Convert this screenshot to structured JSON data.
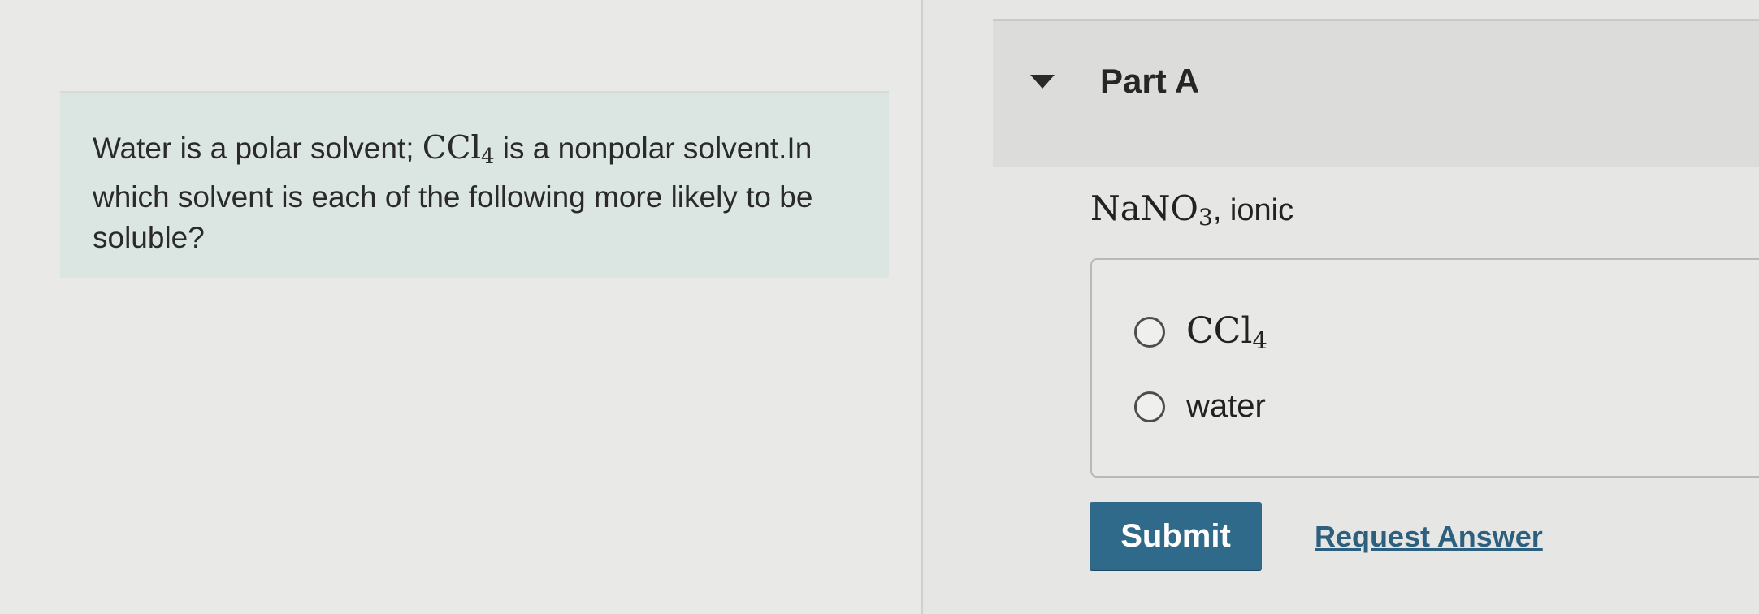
{
  "question": {
    "text_before": "Water is a polar solvent; ",
    "formula_main": "CCl",
    "formula_sub": "4",
    "text_after": " is a nonpolar solvent.In which solvent is each of the following more likely to be soluble?"
  },
  "part": {
    "title": "Part A",
    "caret_icon": "caret-down-icon",
    "prompt_formula_main": "NaNO",
    "prompt_formula_sub": "3",
    "prompt_suffix": ", ionic"
  },
  "options": [
    {
      "label_main": "CCl",
      "label_sub": "4",
      "selected": false
    },
    {
      "label": "water",
      "selected": false
    }
  ],
  "actions": {
    "submit_label": "Submit",
    "request_answer_label": "Request Answer"
  },
  "colors": {
    "question_bg": "#dbe5e2",
    "submit_bg": "#2f6a8a",
    "link": "#2d5f7f"
  }
}
